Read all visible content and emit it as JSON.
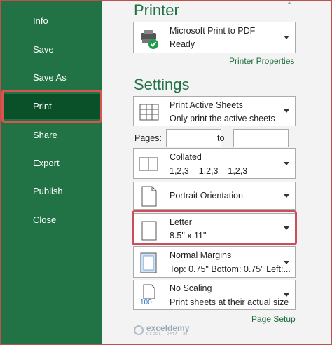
{
  "sidebar": {
    "items": [
      {
        "label": "Info"
      },
      {
        "label": "Save"
      },
      {
        "label": "Save As"
      },
      {
        "label": "Print"
      },
      {
        "label": "Share"
      },
      {
        "label": "Export"
      },
      {
        "label": "Publish"
      },
      {
        "label": "Close"
      }
    ],
    "active": "Print",
    "bg_color": "#217346",
    "active_color": "#0a5129"
  },
  "printer": {
    "heading": "Printer",
    "name": "Microsoft Print to PDF",
    "status": "Ready",
    "properties_link": "Printer Properties"
  },
  "settings": {
    "heading": "Settings",
    "print_what": {
      "title": "Print Active Sheets",
      "subtitle": "Only print the active sheets"
    },
    "pages": {
      "label": "Pages:",
      "to_label": "to",
      "from_value": "",
      "to_value": ""
    },
    "collation": {
      "title": "Collated",
      "subtitle": "1,2,3    1,2,3    1,2,3"
    },
    "orientation": {
      "title": "Portrait Orientation"
    },
    "paper": {
      "title": "Letter",
      "subtitle": "8.5\" x 11\""
    },
    "margins": {
      "title": "Normal Margins",
      "subtitle": "Top: 0.75\" Bottom: 0.75\" Left:..."
    },
    "scaling": {
      "title": "No Scaling",
      "subtitle": "Print sheets at their actual size",
      "icon_text": "100"
    },
    "page_setup_link": "Page Setup"
  },
  "watermark": {
    "name": "exceldemy",
    "tagline": "EXCEL · DATA · BI"
  },
  "colors": {
    "accent": "#217346",
    "highlight": "#c9505a"
  }
}
